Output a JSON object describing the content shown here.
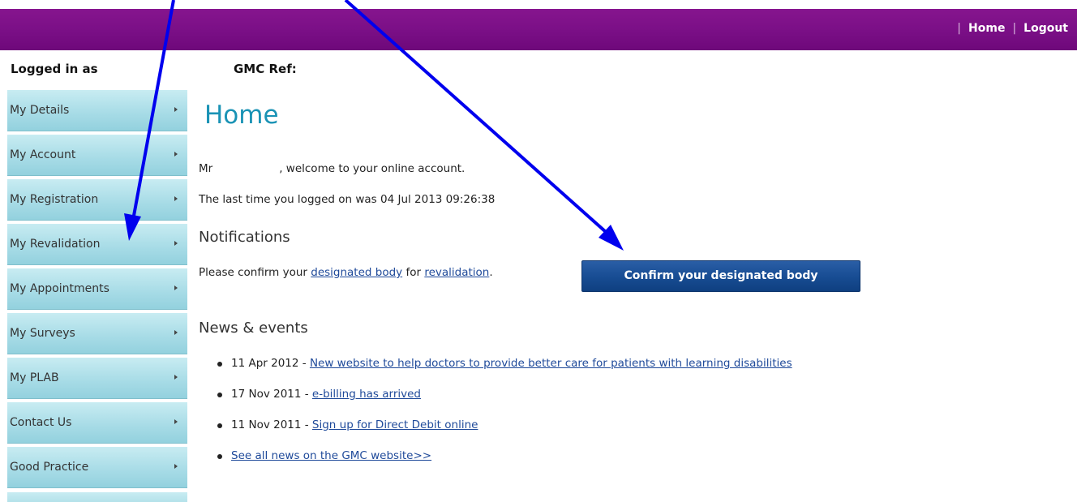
{
  "header": {
    "nav": [
      {
        "label": "Home"
      },
      {
        "label": "Logout"
      }
    ],
    "separator": "|"
  },
  "user_bar": {
    "logged_in_label": "Logged in as",
    "gmc_ref_label": "GMC Ref:"
  },
  "sidebar": {
    "items": [
      {
        "label": "My Details"
      },
      {
        "label": "My Account"
      },
      {
        "label": "My Registration"
      },
      {
        "label": "My Revalidation"
      },
      {
        "label": "My Appointments"
      },
      {
        "label": "My Surveys"
      },
      {
        "label": "My PLAB"
      },
      {
        "label": "Contact Us"
      },
      {
        "label": "Good Practice"
      }
    ]
  },
  "main": {
    "title": "Home",
    "welcome_prefix": "Mr",
    "welcome_suffix": ", welcome to your online account.",
    "last_logon": "The last time you logged on was 04 Jul 2013 09:26:38",
    "notifications": {
      "title": "Notifications",
      "text_prefix": "Please confirm your ",
      "link1": "designated body",
      "text_mid": " for ",
      "link2": "revalidation",
      "text_suffix": ".",
      "button_label": "Confirm your designated body"
    },
    "news": {
      "title": "News & events",
      "items": [
        {
          "date": "11 Apr 2012 - ",
          "link": "New website to help doctors to provide better care for patients with learning disabilities"
        },
        {
          "date": "17 Nov 2011 - ",
          "link": "e-billing has arrived"
        },
        {
          "date": "11 Nov 2011 - ",
          "link": "Sign up for Direct Debit online"
        },
        {
          "date": "",
          "link": "See all news on the GMC website>>"
        }
      ]
    }
  },
  "colors": {
    "header_purple": "#7a0f86",
    "sidebar_teal": "#a6dbe6",
    "title_blue": "#1a93b5",
    "button_blue": "#174c92",
    "link_blue": "#1f4a9a",
    "annotation_arrow": "#0000ee"
  }
}
